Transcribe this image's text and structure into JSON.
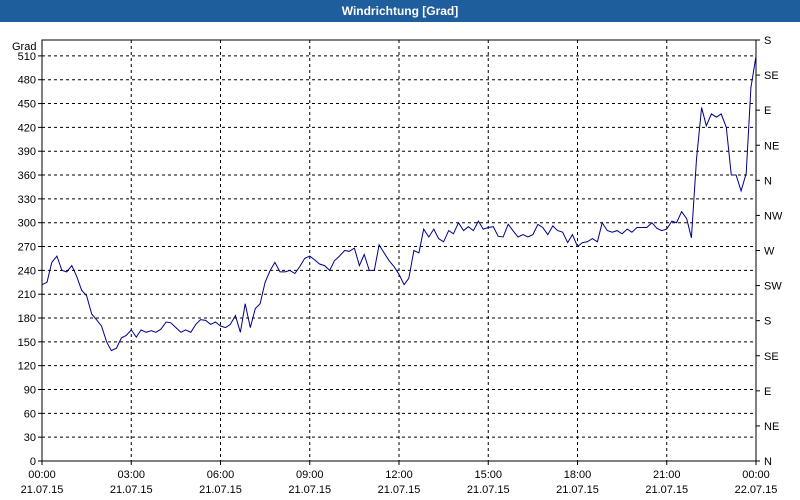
{
  "window": {
    "title": "Windrichtung [Grad]"
  },
  "chart_data": {
    "type": "line",
    "title": "Windrichtung [Grad]",
    "ylabel": "Grad",
    "ylim": [
      0,
      530
    ],
    "yticks": [
      0,
      30,
      60,
      90,
      120,
      150,
      180,
      210,
      240,
      270,
      300,
      330,
      360,
      390,
      420,
      450,
      480,
      510
    ],
    "xlim_hours": [
      0,
      24
    ],
    "xticks": [
      {
        "h": 0,
        "time": "00:00",
        "date": "21.07.15"
      },
      {
        "h": 3,
        "time": "03:00",
        "date": "21.07.15"
      },
      {
        "h": 6,
        "time": "06:00",
        "date": "21.07.15"
      },
      {
        "h": 9,
        "time": "09:00",
        "date": "21.07.15"
      },
      {
        "h": 12,
        "time": "12:00",
        "date": "21.07.15"
      },
      {
        "h": 15,
        "time": "15:00",
        "date": "21.07.15"
      },
      {
        "h": 18,
        "time": "18:00",
        "date": "21.07.15"
      },
      {
        "h": 21,
        "time": "21:00",
        "date": "21.07.15"
      },
      {
        "h": 24,
        "time": "00:00",
        "date": "22.07.15"
      }
    ],
    "right_axis": [
      {
        "v": 0,
        "label": "N"
      },
      {
        "v": 45,
        "label": "NE"
      },
      {
        "v": 90,
        "label": "E"
      },
      {
        "v": 135,
        "label": "SE"
      },
      {
        "v": 180,
        "label": "S"
      },
      {
        "v": 225,
        "label": "SW"
      },
      {
        "v": 270,
        "label": "W"
      },
      {
        "v": 315,
        "label": "NW"
      },
      {
        "v": 360,
        "label": "N"
      },
      {
        "v": 405,
        "label": "NE"
      },
      {
        "v": 450,
        "label": "E"
      },
      {
        "v": 495,
        "label": "SE"
      },
      {
        "v": 540,
        "label": "S"
      }
    ],
    "grid": true,
    "series": [
      {
        "color": "#00008b",
        "points": [
          [
            0.0,
            222
          ],
          [
            0.167,
            225
          ],
          [
            0.33,
            250
          ],
          [
            0.5,
            258
          ],
          [
            0.67,
            240
          ],
          [
            0.83,
            238
          ],
          [
            1.0,
            246
          ],
          [
            1.17,
            232
          ],
          [
            1.33,
            215
          ],
          [
            1.5,
            208
          ],
          [
            1.67,
            185
          ],
          [
            1.83,
            178
          ],
          [
            2.0,
            170
          ],
          [
            2.17,
            150
          ],
          [
            2.33,
            139
          ],
          [
            2.5,
            142
          ],
          [
            2.67,
            155
          ],
          [
            2.83,
            158
          ],
          [
            3.0,
            165
          ],
          [
            3.17,
            156
          ],
          [
            3.33,
            165
          ],
          [
            3.5,
            162
          ],
          [
            3.67,
            164
          ],
          [
            3.83,
            162
          ],
          [
            4.0,
            166
          ],
          [
            4.17,
            175
          ],
          [
            4.33,
            174
          ],
          [
            4.5,
            168
          ],
          [
            4.67,
            162
          ],
          [
            4.83,
            165
          ],
          [
            5.0,
            162
          ],
          [
            5.17,
            172
          ],
          [
            5.33,
            178
          ],
          [
            5.5,
            177
          ],
          [
            5.67,
            172
          ],
          [
            5.83,
            175
          ],
          [
            6.0,
            170
          ],
          [
            6.17,
            168
          ],
          [
            6.33,
            172
          ],
          [
            6.5,
            183
          ],
          [
            6.67,
            162
          ],
          [
            6.83,
            198
          ],
          [
            7.0,
            168
          ],
          [
            7.17,
            192
          ],
          [
            7.33,
            198
          ],
          [
            7.5,
            225
          ],
          [
            7.67,
            240
          ],
          [
            7.83,
            250
          ],
          [
            8.0,
            238
          ],
          [
            8.17,
            238
          ],
          [
            8.33,
            240
          ],
          [
            8.5,
            236
          ],
          [
            8.67,
            245
          ],
          [
            8.83,
            255
          ],
          [
            9.0,
            258
          ],
          [
            9.17,
            253
          ],
          [
            9.33,
            248
          ],
          [
            9.5,
            246
          ],
          [
            9.67,
            240
          ],
          [
            9.83,
            252
          ],
          [
            10.0,
            258
          ],
          [
            10.17,
            265
          ],
          [
            10.33,
            264
          ],
          [
            10.5,
            268
          ],
          [
            10.67,
            246
          ],
          [
            10.83,
            260
          ],
          [
            11.0,
            240
          ],
          [
            11.17,
            240
          ],
          [
            11.33,
            272
          ],
          [
            11.5,
            262
          ],
          [
            11.67,
            252
          ],
          [
            11.83,
            245
          ],
          [
            12.0,
            235
          ],
          [
            12.17,
            222
          ],
          [
            12.33,
            230
          ],
          [
            12.5,
            265
          ],
          [
            12.67,
            262
          ],
          [
            12.83,
            292
          ],
          [
            13.0,
            282
          ],
          [
            13.17,
            292
          ],
          [
            13.33,
            280
          ],
          [
            13.5,
            276
          ],
          [
            13.67,
            290
          ],
          [
            13.83,
            286
          ],
          [
            14.0,
            300
          ],
          [
            14.17,
            290
          ],
          [
            14.33,
            295
          ],
          [
            14.5,
            290
          ],
          [
            14.67,
            302
          ],
          [
            14.83,
            292
          ],
          [
            15.0,
            294
          ],
          [
            15.17,
            295
          ],
          [
            15.33,
            283
          ],
          [
            15.5,
            282
          ],
          [
            15.67,
            298
          ],
          [
            15.83,
            290
          ],
          [
            16.0,
            282
          ],
          [
            16.17,
            285
          ],
          [
            16.33,
            282
          ],
          [
            16.5,
            285
          ],
          [
            16.67,
            298
          ],
          [
            16.83,
            294
          ],
          [
            17.0,
            285
          ],
          [
            17.17,
            296
          ],
          [
            17.33,
            290
          ],
          [
            17.5,
            288
          ],
          [
            17.67,
            275
          ],
          [
            17.83,
            285
          ],
          [
            18.0,
            270
          ],
          [
            18.17,
            275
          ],
          [
            18.33,
            276
          ],
          [
            18.5,
            280
          ],
          [
            18.67,
            276
          ],
          [
            18.83,
            300
          ],
          [
            19.0,
            290
          ],
          [
            19.17,
            288
          ],
          [
            19.33,
            290
          ],
          [
            19.5,
            286
          ],
          [
            19.67,
            292
          ],
          [
            19.83,
            288
          ],
          [
            20.0,
            294
          ],
          [
            20.17,
            294
          ],
          [
            20.33,
            294
          ],
          [
            20.5,
            300
          ],
          [
            20.67,
            293
          ],
          [
            20.83,
            290
          ],
          [
            21.0,
            292
          ],
          [
            21.17,
            302
          ],
          [
            21.33,
            300
          ],
          [
            21.5,
            314
          ],
          [
            21.67,
            305
          ],
          [
            21.83,
            281
          ],
          [
            22.0,
            380
          ],
          [
            22.17,
            445
          ],
          [
            22.33,
            422
          ],
          [
            22.5,
            437
          ],
          [
            22.67,
            433
          ],
          [
            22.83,
            437
          ],
          [
            23.0,
            420
          ],
          [
            23.17,
            360
          ],
          [
            23.33,
            360
          ],
          [
            23.5,
            340
          ],
          [
            23.67,
            362
          ],
          [
            23.83,
            470
          ],
          [
            24.0,
            510
          ]
        ]
      }
    ]
  }
}
